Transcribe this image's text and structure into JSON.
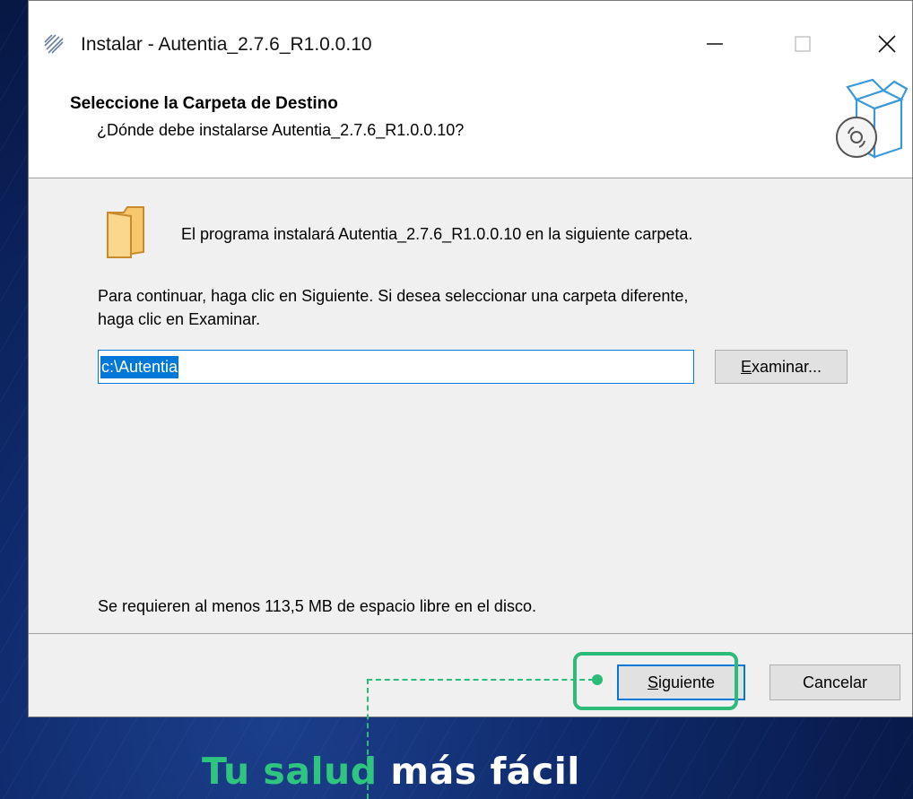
{
  "window": {
    "title": "Instalar - Autentia_2.7.6_R1.0.0.10",
    "controls": [
      "minimize",
      "maximize",
      "close"
    ]
  },
  "header": {
    "title": "Seleccione la Carpeta de Destino",
    "subtitle": "¿Dónde debe instalarse Autentia_2.7.6_R1.0.0.10?"
  },
  "body": {
    "install_message": "El programa instalará Autentia_2.7.6_R1.0.0.10 en la siguiente carpeta.",
    "instruction_line1": "Para continuar, haga clic en Siguiente. Si desea seleccionar una carpeta diferente,",
    "instruction_line2": "haga clic en Examinar.",
    "path_value": "c:\\Autentia",
    "browse_label_accel": "E",
    "browse_label_rest": "xaminar...",
    "space_required": "Se requieren al menos 113,5 MB de espacio libre en el disco."
  },
  "footer": {
    "next_accel": "S",
    "next_rest": "iguiente",
    "cancel_label": "Cancelar"
  },
  "brand": {
    "part1": "Tu salud",
    "part2": "más fácil",
    "accent_color": "#2fc47f"
  },
  "icons": [
    "installer-app-icon",
    "minimize-icon",
    "maximize-icon",
    "close-icon",
    "setup-box-icon",
    "folder-icon"
  ]
}
